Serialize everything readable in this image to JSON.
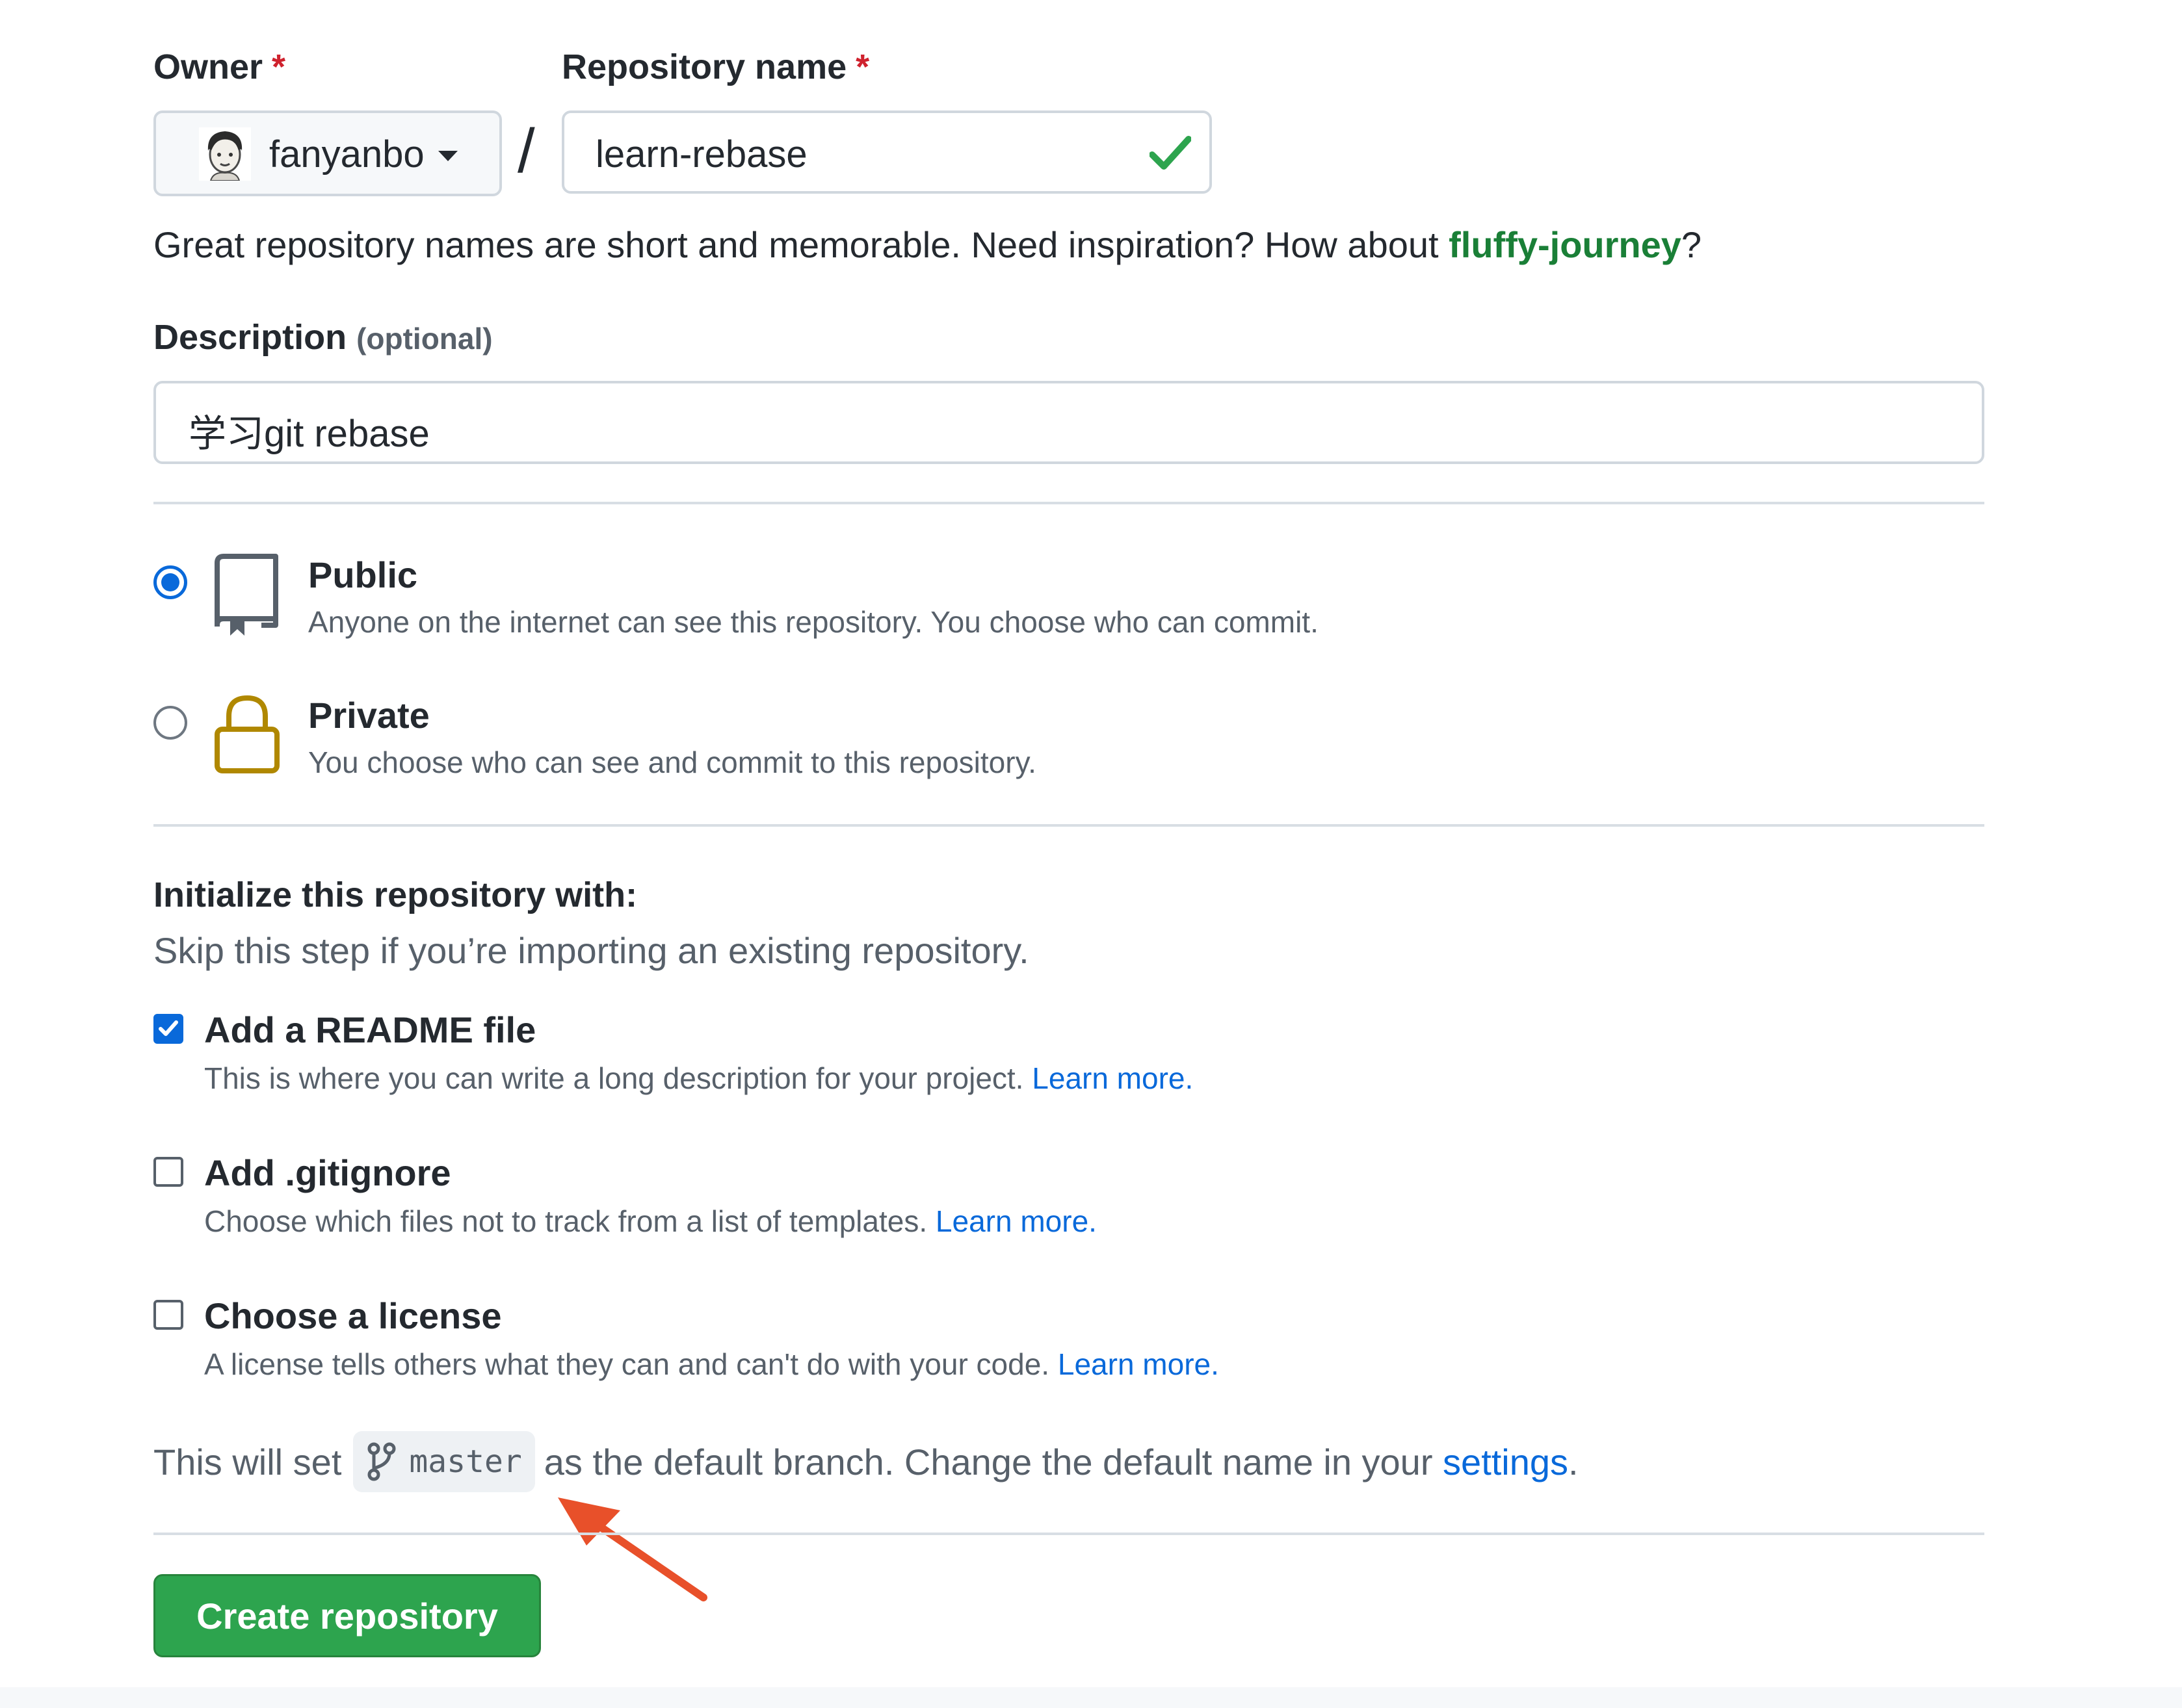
{
  "owner": {
    "label": "Owner",
    "required_mark": "*",
    "value": "fanyanbo"
  },
  "separator": "/",
  "repo_name": {
    "label": "Repository name",
    "required_mark": "*",
    "value": "learn-rebase"
  },
  "name_hint": {
    "text_before": "Great repository names are short and memorable. Need inspiration? How about ",
    "suggestion": "fluffy-journey",
    "text_after": "?"
  },
  "description": {
    "label": "Description",
    "optional_text": "(optional)",
    "value": "学习git rebase"
  },
  "visibility": {
    "public": {
      "title": "Public",
      "desc": "Anyone on the internet can see this repository. You choose who can commit.",
      "checked": true
    },
    "private": {
      "title": "Private",
      "desc": "You choose who can see and commit to this repository.",
      "checked": false
    }
  },
  "initialize": {
    "title": "Initialize this repository with:",
    "subtitle": "Skip this step if you’re importing an existing repository.",
    "readme": {
      "title": "Add a README file",
      "desc": "This is where you can write a long description for your project.",
      "link": "Learn more.",
      "checked": true
    },
    "gitignore": {
      "title": "Add .gitignore",
      "desc": "Choose which files not to track from a list of templates.",
      "link": "Learn more.",
      "checked": false
    },
    "license": {
      "title": "Choose a license",
      "desc": "A license tells others what they can and can't do with your code.",
      "link": "Learn more.",
      "checked": false
    }
  },
  "branch": {
    "text_before": "This will set",
    "name": "master",
    "text_after": "as the default branch. Change the default name in your",
    "settings_link": "settings",
    "period": "."
  },
  "create_button": "Create repository",
  "colors": {
    "accent_blue": "#0969da",
    "success_green": "#2da44e",
    "link_green": "#1a7f37",
    "required_red": "#cf222e",
    "arrow_orange": "#e8502a",
    "lock_gold": "#b08800"
  },
  "icons": [
    "avatar",
    "caret-down-icon",
    "check-icon",
    "repo-icon",
    "lock-icon",
    "git-branch-icon",
    "annotation-arrow"
  ]
}
